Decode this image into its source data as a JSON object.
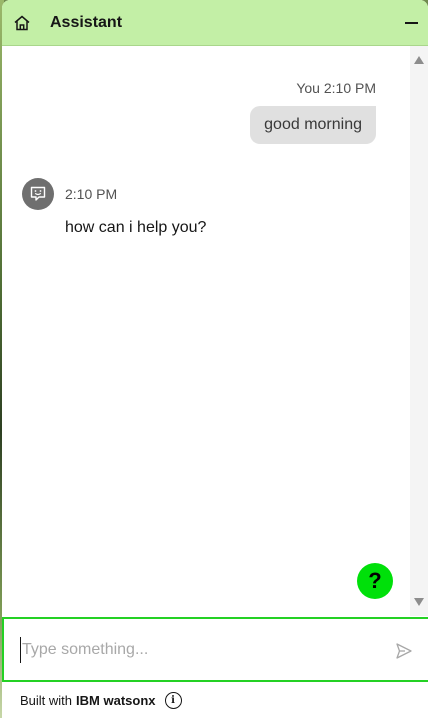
{
  "header": {
    "title": "Assistant",
    "home_icon": "home-icon",
    "minimize_icon": "minimize-icon"
  },
  "conversation": {
    "user_message": {
      "sender": "You",
      "time": "2:10 PM",
      "text": "good morning"
    },
    "bot_message": {
      "avatar_icon": "chat-bot-icon",
      "time": "2:10 PM",
      "text": "how can i help you?"
    }
  },
  "help_button": {
    "label": "?"
  },
  "input": {
    "value": "",
    "placeholder": "Type something...",
    "send_icon": "send-icon"
  },
  "footer": {
    "built_with": "Built with",
    "brand": "IBM watsonx",
    "info_icon": "info-icon"
  },
  "colors": {
    "header_bg": "#c3efa6",
    "input_border": "#24d124",
    "help_button_bg": "#00e00a",
    "user_bubble_bg": "#e0e0e0",
    "avatar_bg": "#6f6f6f"
  }
}
